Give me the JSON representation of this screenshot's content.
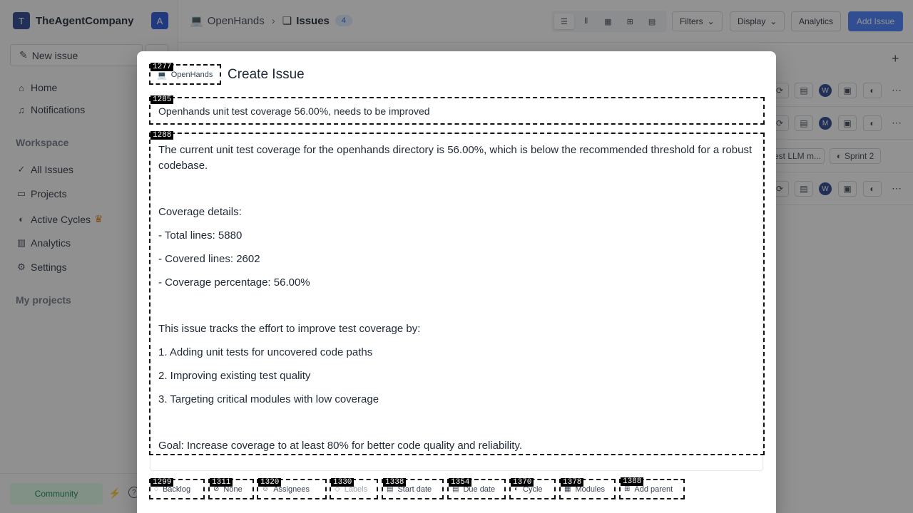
{
  "workspace": {
    "initial": "T",
    "name": "TheAgentCompany",
    "user_initial": "A"
  },
  "sidebar": {
    "new_issue": "New issue",
    "nav": [
      {
        "label": "Home"
      },
      {
        "label": "Notifications"
      }
    ],
    "workspace_heading": "Workspace",
    "workspace_items": [
      {
        "label": "All Issues"
      },
      {
        "label": "Projects"
      },
      {
        "label": "Active Cycles"
      },
      {
        "label": "Analytics"
      },
      {
        "label": "Settings"
      }
    ],
    "my_projects_heading": "My projects",
    "community": "Community"
  },
  "header": {
    "project": "OpenHands",
    "page": "Issues",
    "count": "4",
    "filters": "Filters",
    "display": "Display",
    "analytics": "Analytics",
    "add_issue": "Add Issue"
  },
  "rows": [
    {
      "assignee": "W"
    },
    {
      "assignee": "M"
    },
    {
      "label_chip": "est LLM m...",
      "cycle_chip": "Sprint 2"
    },
    {
      "assignee": "W"
    }
  ],
  "modal": {
    "project_selector": "OpenHands",
    "title": "Create Issue",
    "issue_title": "Openhands unit test coverage 56.00%, needs to be improved",
    "description": [
      "The current unit test coverage for the openhands directory is 56.00%, which is below the recommended threshold for a robust codebase.",
      "",
      "Coverage details:",
      "- Total lines: 5880",
      "- Covered lines: 2602",
      "- Coverage percentage: 56.00%",
      "",
      "This issue tracks the effort to improve test coverage by:",
      "1. Adding unit tests for uncovered code paths",
      "2. Improving existing test quality",
      "3. Targeting critical modules with low coverage",
      "",
      "Goal: Increase coverage to at least 80% for better code quality and reliability."
    ],
    "props": {
      "state": "Backlog",
      "priority": "None",
      "assignees": "Assignees",
      "labels": "Labels",
      "start_date": "Start date",
      "due_date": "Due date",
      "cycle": "Cycle",
      "modules": "Modules",
      "add_parent": "Add parent"
    }
  },
  "marks": [
    "1277",
    "1285",
    "1288",
    "1299",
    "1311",
    "1320",
    "1330",
    "1338",
    "1354",
    "1370",
    "1378",
    "1388"
  ]
}
